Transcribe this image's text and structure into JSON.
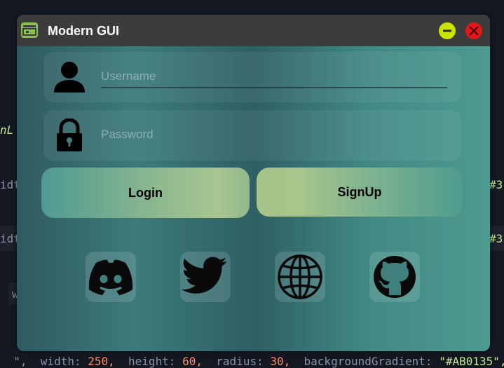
{
  "background_code": {
    "line1": "nL",
    "line2_left": "idtl",
    "line2_right": "#3",
    "line3_left": "idtl",
    "line3_right": "#3",
    "line4_left": "w",
    "line5_prefix": "\",",
    "line5_width_key": "width:",
    "line5_width_val": "250,",
    "line5_height_key": "height:",
    "line5_height_val": "60,",
    "line5_radius_key": "radius:",
    "line5_radius_val": "30,",
    "line5_bg_key": "backgroundGradient:",
    "line5_bg_val": "\"#AB0135\","
  },
  "window": {
    "title": "Modern GUI",
    "app_icon": "app-window-icon",
    "minimize_icon": "minimize-icon",
    "close_icon": "close-icon"
  },
  "form": {
    "username": {
      "placeholder": "Username",
      "value": "",
      "icon": "user-icon"
    },
    "password": {
      "placeholder": "Password",
      "value": "",
      "icon": "lock-icon"
    },
    "login_label": "Login",
    "signup_label": "SignUp"
  },
  "social": [
    {
      "name": "discord",
      "icon": "discord-icon"
    },
    {
      "name": "twitter",
      "icon": "twitter-icon"
    },
    {
      "name": "website",
      "icon": "globe-icon"
    },
    {
      "name": "github",
      "icon": "github-icon"
    }
  ],
  "colors": {
    "titlebar": "#3c3c3c",
    "minimize": "#c9e400",
    "close": "#e21818",
    "app_icon": "#8bc34a"
  }
}
